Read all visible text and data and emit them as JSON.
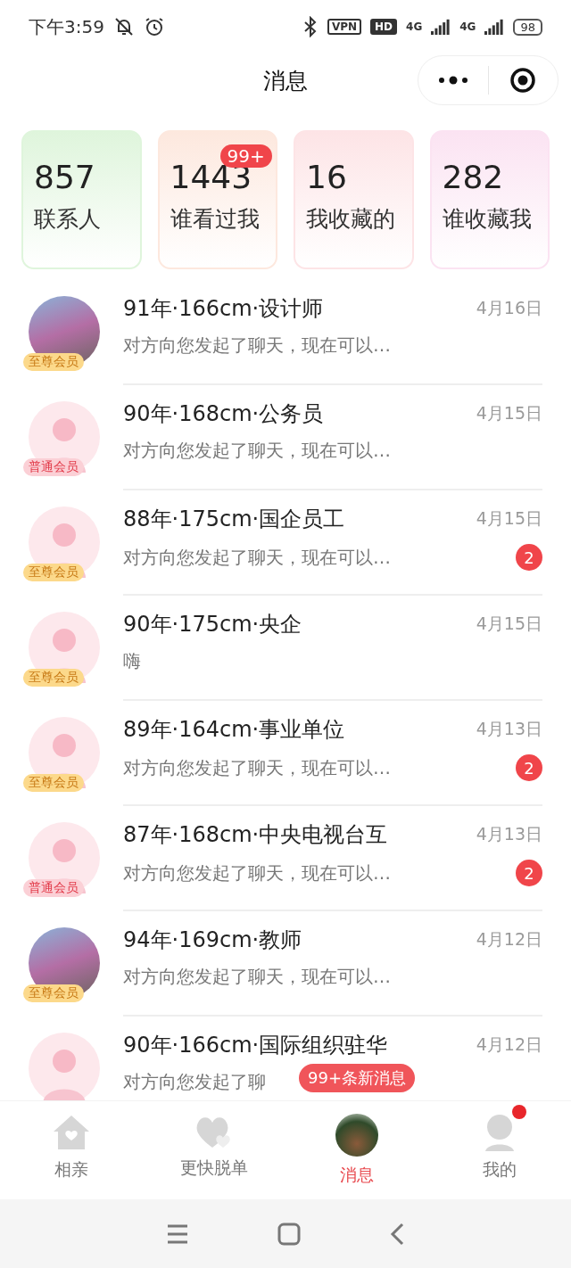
{
  "status_bar": {
    "time": "下午3:59",
    "vpn": "VPN",
    "hd": "HD",
    "networks": [
      "4G",
      "4G"
    ],
    "battery": "98"
  },
  "header": {
    "title": "消息"
  },
  "stats": [
    {
      "value": "857",
      "label": "联系人",
      "color": "#dff5dc"
    },
    {
      "value": "1443",
      "label": "谁看过我",
      "color": "#fde8de",
      "badge": "99+"
    },
    {
      "value": "16",
      "label": "我收藏的",
      "color": "#fde4e6"
    },
    {
      "value": "282",
      "label": "谁收藏我",
      "color": "#fbe3f2"
    }
  ],
  "messages": [
    {
      "title": "91年·166cm·设计师",
      "date": "4月16日",
      "preview": "对方向您发起了聊天，现在可以…",
      "avatar": {
        "kind": "photo"
      },
      "member": {
        "kind": "supreme",
        "label": "至尊会员"
      }
    },
    {
      "title": "90年·168cm·公务员",
      "date": "4月15日",
      "preview": "对方向您发起了聊天，现在可以…",
      "avatar": {
        "kind": "default"
      },
      "member": {
        "kind": "regular",
        "label": "普通会员"
      }
    },
    {
      "title": "88年·175cm·国企员工",
      "date": "4月15日",
      "preview": "对方向您发起了聊天，现在可以…",
      "avatar": {
        "kind": "default"
      },
      "member": {
        "kind": "supreme",
        "label": "至尊会员"
      },
      "unread": "2"
    },
    {
      "title": "90年·175cm·央企",
      "date": "4月15日",
      "preview": "嗨",
      "avatar": {
        "kind": "default"
      },
      "member": {
        "kind": "supreme",
        "label": "至尊会员"
      }
    },
    {
      "title": "89年·164cm·事业单位",
      "date": "4月13日",
      "preview": "对方向您发起了聊天，现在可以…",
      "avatar": {
        "kind": "default"
      },
      "member": {
        "kind": "supreme",
        "label": "至尊会员"
      },
      "unread": "2"
    },
    {
      "title": "87年·168cm·中央电视台互",
      "date": "4月13日",
      "preview": "对方向您发起了聊天，现在可以…",
      "avatar": {
        "kind": "default"
      },
      "member": {
        "kind": "regular",
        "label": "普通会员"
      },
      "unread": "2"
    },
    {
      "title": "94年·169cm·教师",
      "date": "4月12日",
      "preview": "对方向您发起了聊天，现在可以…",
      "avatar": {
        "kind": "photo"
      },
      "member": {
        "kind": "supreme",
        "label": "至尊会员"
      }
    },
    {
      "title": "90年·166cm·国际组织驻华",
      "date": "4月12日",
      "preview": "对方向您发起了聊",
      "avatar": {
        "kind": "default"
      }
    }
  ],
  "tabs": [
    {
      "label": "相亲",
      "kind": "home",
      "selected": false,
      "dot": false
    },
    {
      "label": "更快脱单",
      "kind": "hearts",
      "selected": false,
      "dot": false
    },
    {
      "label": "消息",
      "kind": "photo",
      "selected": true,
      "dot": false,
      "tooltip": "99+条新消息"
    },
    {
      "label": "我的",
      "kind": "person",
      "selected": false,
      "dot": true
    }
  ]
}
